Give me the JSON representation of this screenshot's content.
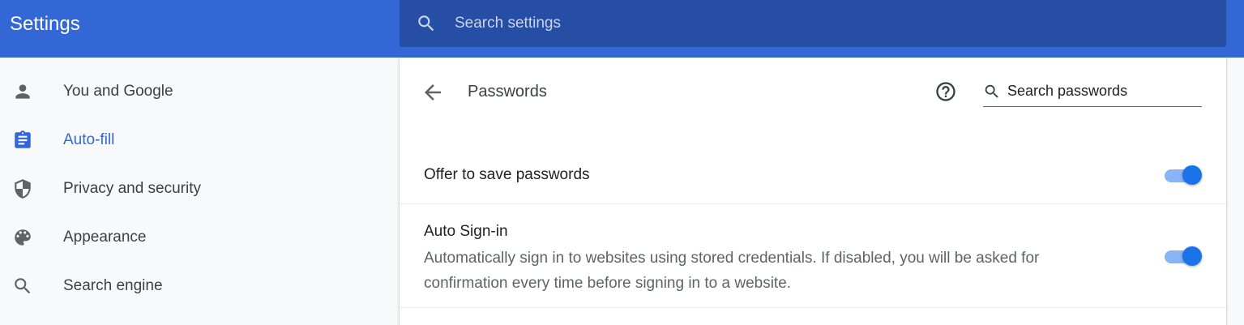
{
  "header": {
    "title": "Settings",
    "search_placeholder": "Search settings",
    "search_icon": "search-icon"
  },
  "sidebar": {
    "items": [
      {
        "label": "You and Google",
        "icon": "person-icon",
        "active": false
      },
      {
        "label": "Auto-fill",
        "icon": "clipboard-icon",
        "active": true
      },
      {
        "label": "Privacy and security",
        "icon": "shield-icon",
        "active": false
      },
      {
        "label": "Appearance",
        "icon": "palette-icon",
        "active": false
      },
      {
        "label": "Search engine",
        "icon": "search-icon",
        "active": false
      }
    ]
  },
  "passwords": {
    "title": "Passwords",
    "back_icon": "back-arrow-icon",
    "help_icon": "help-icon",
    "search_placeholder": "Search passwords",
    "settings": [
      {
        "title": "Offer to save passwords",
        "description": "",
        "enabled": true
      },
      {
        "title": "Auto Sign-in",
        "description": "Automatically sign in to websites using stored credentials. If disabled, you will be asked for confirmation every time before signing in to a website.",
        "enabled": true
      }
    ]
  },
  "colors": {
    "header_bg": "#3367d6",
    "search_bg": "#264ea5",
    "active_nav": "#3367d6",
    "toggle_on": "#1a73e8",
    "toggle_track": "#8ab4f8"
  }
}
